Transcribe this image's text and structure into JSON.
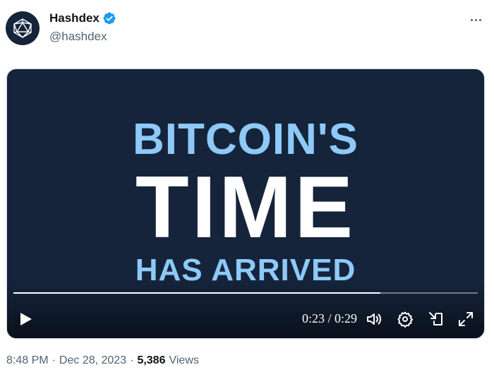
{
  "author": {
    "name": "Hashdex",
    "handle": "@hashdex",
    "verified_color": "#1d9bf0",
    "avatar_icon": "icosahedron-logo-icon"
  },
  "more_icon": "more-horizontal-icon",
  "video": {
    "background": "#15243b",
    "text_line1": "BITCOIN'S",
    "text_line2": "TIME",
    "text_line3": "HAS ARRIVED",
    "progress_fraction": 0.79,
    "time_display": "0:23 / 0:29",
    "controls": [
      "play-icon",
      "volume-icon",
      "settings-icon",
      "dock-icon",
      "fullscreen-icon"
    ]
  },
  "meta": {
    "time": "8:48 PM",
    "separator": "·",
    "date": "Dec 28, 2023",
    "views_count": "5,386",
    "views_label": "Views"
  }
}
